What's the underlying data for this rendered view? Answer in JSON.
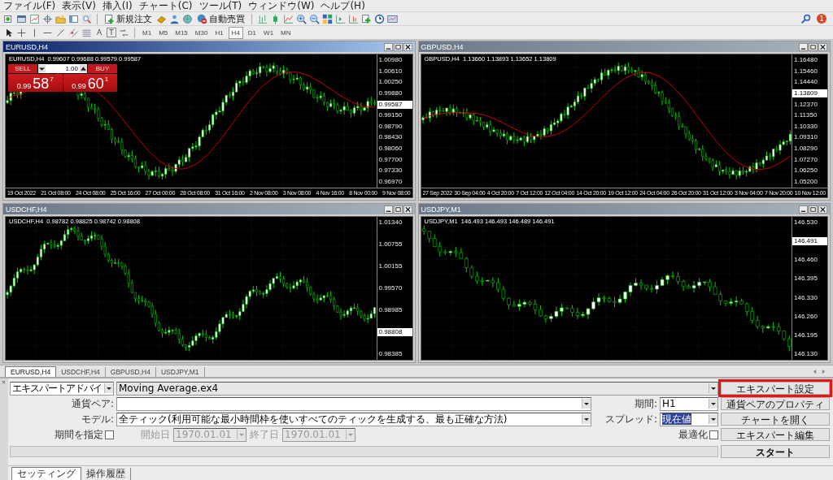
{
  "menu": [
    "ファイル(F)",
    "表示(V)",
    "挿入(I)",
    "チャート(C)",
    "ツール(T)",
    "ウィンドウ(W)",
    "ヘルプ(H)"
  ],
  "toolbar": {
    "new_order": "新規注文",
    "auto_trading": "自動売買",
    "text_tools": [
      "A",
      "T"
    ],
    "timeframes": [
      {
        "label": "M1",
        "selected": false
      },
      {
        "label": "M5",
        "selected": false
      },
      {
        "label": "M15",
        "selected": false
      },
      {
        "label": "M30",
        "selected": false
      },
      {
        "label": "H1",
        "selected": false
      },
      {
        "label": "H4",
        "selected": true
      },
      {
        "label": "D1",
        "selected": false
      },
      {
        "label": "W1",
        "selected": false
      },
      {
        "label": "MN",
        "selected": false
      }
    ],
    "notification_count": "1"
  },
  "charts": [
    {
      "title": "EURUSD,H4",
      "active": true,
      "header": "EURUSD,H4  0.99607 0.99688 0.99579 0.99587",
      "price_labels": [
        {
          "text": "1.00980",
          "current": false
        },
        {
          "text": "1.00610",
          "current": false
        },
        {
          "text": "1.00250",
          "current": false
        },
        {
          "text": "0.99880",
          "current": false
        },
        {
          "text": "0.99587",
          "current": true
        },
        {
          "text": "0.99150",
          "current": false
        },
        {
          "text": "0.98790",
          "current": false
        },
        {
          "text": "0.98430",
          "current": false
        },
        {
          "text": "0.98060",
          "current": false
        },
        {
          "text": "0.97700",
          "current": false
        },
        {
          "text": "0.97330",
          "current": false
        },
        {
          "text": "0.96970",
          "current": false
        }
      ],
      "time_labels": [
        "19 Oct 2022",
        "21 Oct 08:00",
        "24 Oct 08:00",
        "25 Oct 16:00",
        "27 Oct 00:00",
        "28 Oct 08:00",
        "31 Oct 16:00",
        "2 Nov 08:00",
        "3 Nov 08:00",
        "4 Nov 16:00",
        "8 Nov 00:00",
        "9 Nov 08:00"
      ],
      "trade_panel": {
        "sell": "SELL",
        "buy": "BUY",
        "lots": "1.00",
        "sell_price": {
          "prefix": "0.99",
          "big": "58",
          "sup": "7"
        },
        "buy_price": {
          "prefix": "0.99",
          "big": "60",
          "sup": "1"
        }
      }
    },
    {
      "title": "GBPUSD,H4",
      "active": false,
      "header": "GBPUSD,H4  1.13660 1.13893 1.13652 1.13809",
      "price_labels": [
        {
          "text": "1.16480",
          "current": false
        },
        {
          "text": "1.15460",
          "current": false
        },
        {
          "text": "1.14440",
          "current": false
        },
        {
          "text": "1.13809",
          "current": true
        },
        {
          "text": "1.12370",
          "current": false
        },
        {
          "text": "1.11350",
          "current": false
        },
        {
          "text": "1.10330",
          "current": false
        },
        {
          "text": "1.09310",
          "current": false
        },
        {
          "text": "1.08290",
          "current": false
        },
        {
          "text": "1.07270",
          "current": false
        },
        {
          "text": "1.06250",
          "current": false
        },
        {
          "text": "1.05200",
          "current": false
        }
      ],
      "time_labels": [
        "27 Sep 2022",
        "30 Sep 04:00",
        "4 Oct 20:00",
        "7 Oct 12:00",
        "12 Oct 04:00",
        "14 Oct 20:00",
        "19 Oct 12:00",
        "24 Oct 04:00",
        "26 Oct 20:00",
        "31 Oct 12:00",
        "3 Nov 04:00",
        "7 Nov 20:00",
        "10 Nov 12:00"
      ]
    },
    {
      "title": "USDCHF,H4",
      "active": false,
      "header": "USDCHF,H4  0.98782 0.98825 0.98742 0.98808",
      "price_labels": [
        {
          "text": "1.01340",
          "current": false
        },
        {
          "text": "1.00755",
          "current": false
        },
        {
          "text": "1.00155",
          "current": false
        },
        {
          "text": "0.99570",
          "current": false
        },
        {
          "text": "0.98985",
          "current": false
        },
        {
          "text": "0.98808",
          "current": true
        },
        {
          "text": "0.98385",
          "current": false
        }
      ]
    },
    {
      "title": "USDJPY,M1",
      "active": false,
      "header": "USDJPY,M1  146.493 146.493 146.489 146.491",
      "price_labels": [
        {
          "text": "146.530",
          "current": false
        },
        {
          "text": "146.491",
          "current": true
        },
        {
          "text": "146.460",
          "current": false
        },
        {
          "text": "146.395",
          "current": false
        },
        {
          "text": "146.330",
          "current": false
        },
        {
          "text": "146.260",
          "current": false
        },
        {
          "text": "146.195",
          "current": false
        },
        {
          "text": "146.130",
          "current": false
        }
      ]
    }
  ],
  "chart_tabs": [
    {
      "label": "EURUSD,H4",
      "selected": true
    },
    {
      "label": "USDCHF,H4",
      "selected": false
    },
    {
      "label": "GBPUSD,H4",
      "selected": false
    },
    {
      "label": "USDJPY,M1",
      "selected": false
    }
  ],
  "tester": {
    "type": "エキスパートアドバイ",
    "expert": "Moving Average.ex4",
    "symbol_label": "通貨ペア:",
    "model_label": "モデル:",
    "model": "全ティック(利用可能な最小時間枠を使いすべてのティックを生成する、最も正確な方法)",
    "date_range": {
      "label": "期間を指定",
      "checked": false
    },
    "start_label": "開始日",
    "start": "1970.01.01",
    "end_label": "終了日",
    "end": "1970.01.01",
    "period_label": "期間:",
    "period": "H1",
    "spread_label": "スプレッド:",
    "spread": "現在値",
    "optimize": {
      "label": "最適化",
      "checked": false
    },
    "buttons": [
      {
        "label": "エキスパート設定",
        "highlighted": true
      },
      {
        "label": "通貨ペアのプロパティ",
        "highlighted": false
      },
      {
        "label": "チャートを開く",
        "highlighted": false
      },
      {
        "label": "エキスパート編集",
        "highlighted": false
      }
    ],
    "start_button": "スタート",
    "progress": {
      "level": 0
    }
  },
  "bottom_tabs": [
    {
      "label": "セッティング",
      "selected": true
    },
    {
      "label": "操作履歴",
      "selected": false
    }
  ]
}
